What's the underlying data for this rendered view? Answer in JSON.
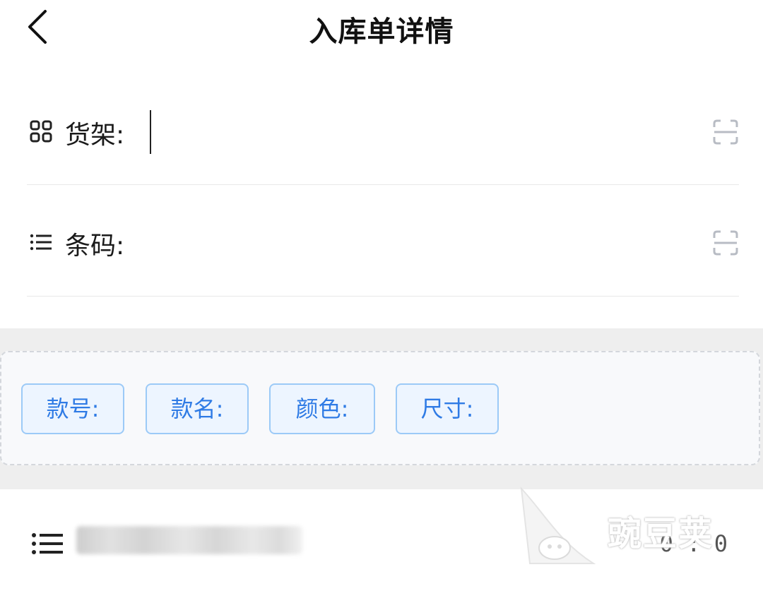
{
  "header": {
    "title": "入库单详情"
  },
  "shelf_row": {
    "label": "货架:",
    "value": "",
    "icon": "grid-icon",
    "scan_icon": "scan-icon"
  },
  "barcode_row": {
    "label": "条码:",
    "value": "",
    "icon": "list-icon",
    "scan_icon": "scan-icon"
  },
  "tags": [
    {
      "label": "款号:"
    },
    {
      "label": "款名:"
    },
    {
      "label": "颜色:"
    },
    {
      "label": "尺寸:"
    }
  ],
  "list_item": {
    "icon": "list-icon",
    "count": "0 : 0"
  },
  "watermark": {
    "text": "豌豆荚"
  },
  "colors": {
    "tag_text": "#2f7be5",
    "tag_border": "#9ccaf7",
    "tag_bg": "#edf5ff",
    "band_bg": "#eeeeee"
  }
}
